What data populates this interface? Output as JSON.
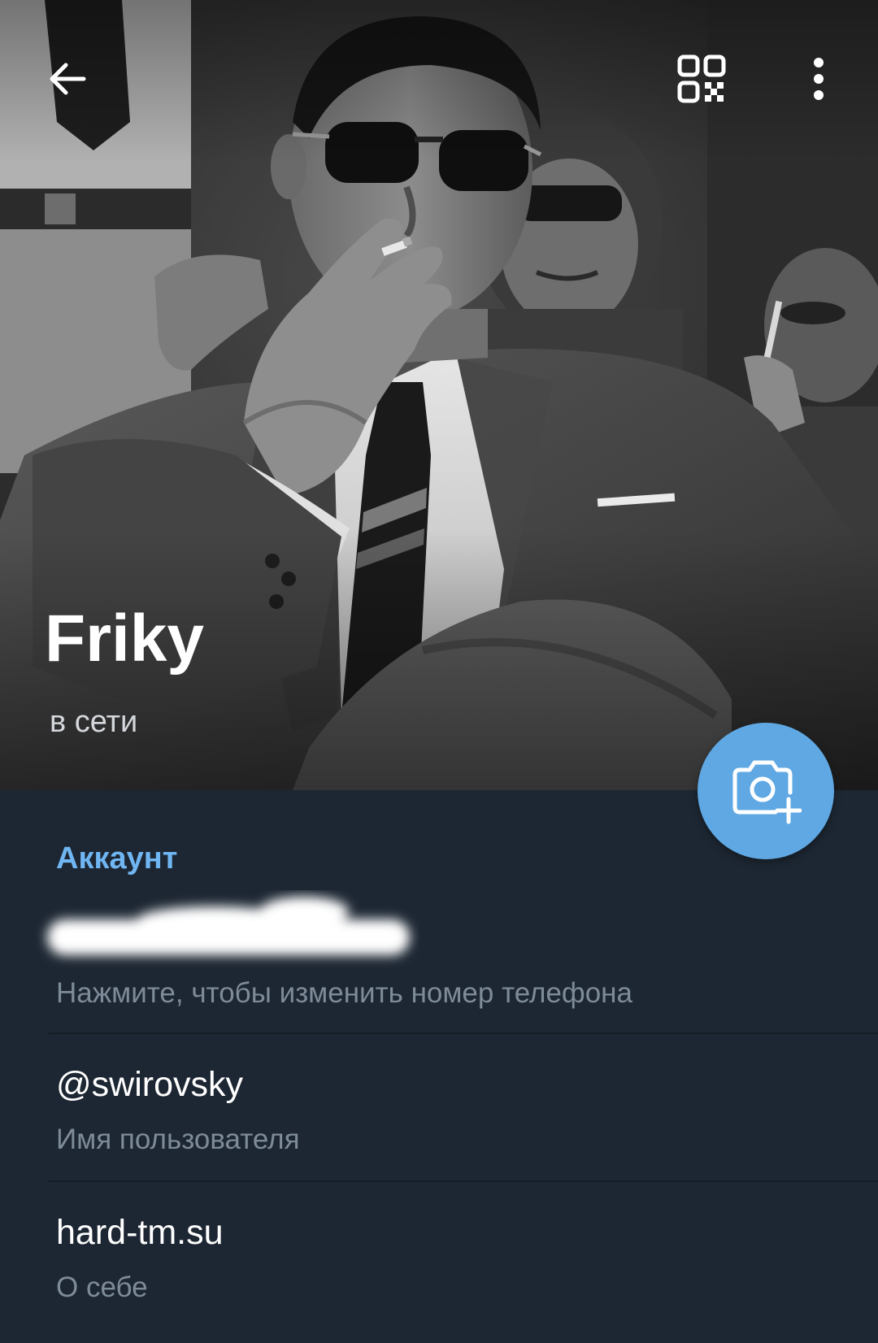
{
  "header": {
    "back_icon": "arrow-left-icon",
    "qr_icon": "qr-code-icon",
    "menu_icon": "more-vertical-icon"
  },
  "profile": {
    "name": "Friky",
    "status": "в сети"
  },
  "camera_fab": {
    "icon": "camera-add-icon",
    "color": "#5fa8e3"
  },
  "account": {
    "section_title": "Аккаунт",
    "phone": {
      "hint": "Нажмите, чтобы изменить номер телефона"
    },
    "username": {
      "value": "@swirovsky",
      "label": "Имя пользователя"
    },
    "bio": {
      "value": "hard-tm.su",
      "label": "О себе"
    }
  },
  "colors": {
    "background": "#1d2733",
    "accent": "#70b6f2",
    "secondary_text": "#7e8b98"
  }
}
